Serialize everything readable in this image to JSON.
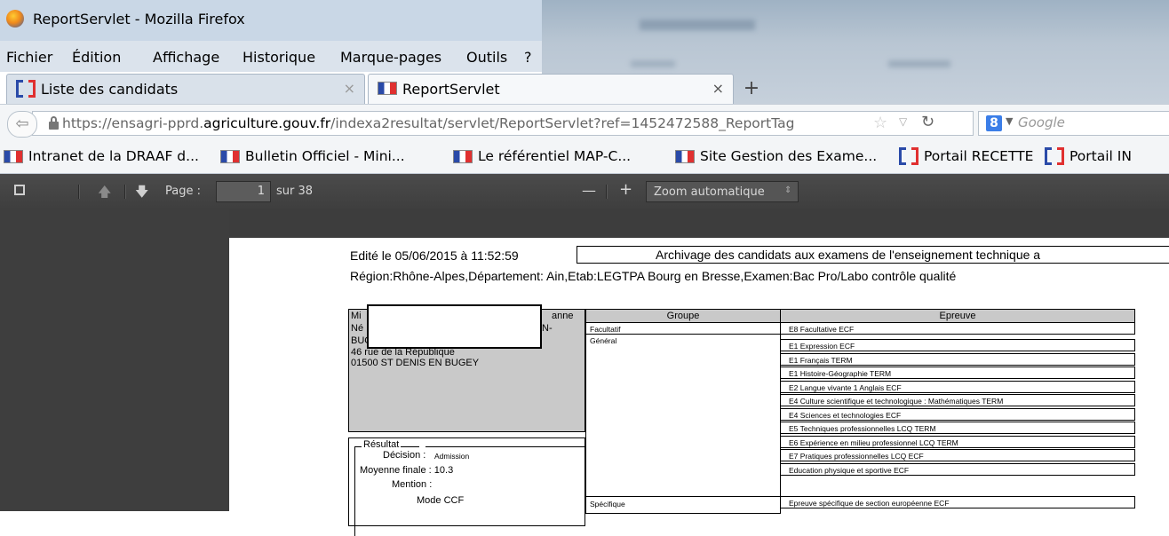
{
  "window": {
    "title": "ReportServlet - Mozilla Firefox"
  },
  "menu": [
    "Fichier",
    "Édition",
    "Affichage",
    "Historique",
    "Marque-pages",
    "Outils",
    "?"
  ],
  "tabs": [
    {
      "label": "Liste des candidats",
      "close": "×"
    },
    {
      "label": "ReportServlet",
      "close": "×"
    }
  ],
  "new_tab": "+",
  "url": {
    "prefix": "https://ensagri-pprd.",
    "domain": "agriculture.gouv.fr",
    "suffix": "/indexa2resultat/servlet/ReportServlet?ref=1452472588_ReportTag"
  },
  "search": {
    "placeholder": "Google",
    "engine_icon": "8"
  },
  "bookmarks": [
    "Intranet de la DRAAF d...",
    "Bulletin Officiel - Mini...",
    "Le référentiel MAP-C...",
    "Site Gestion des Exame...",
    "Portail RECETTE",
    "Portail IN"
  ],
  "pdf_toolbar": {
    "page_label": "Page :",
    "page_value": "1",
    "page_total": "sur 38",
    "zoom_minus": "—",
    "zoom_plus": "+",
    "zoom_value": "Zoom automatique"
  },
  "report": {
    "edited": "Edité le 05/06/2015 à  11:52:59",
    "archive_title": "Archivage des candidats aux examens de l'enseignement technique a",
    "region_line": "Région:Rhône-Alpes,Département: Ain,Etab:LEGTPA Bourg en Bresse,Examen:Bac Pro/Labo contrôle qualité",
    "candidate": {
      "line1_start": "Mi",
      "line1_end": "anne",
      "line2_start": "Né",
      "line2_end": "N-",
      "line3": "BUGEY (AIN)",
      "line4": "46 rue de la République",
      "line5": "01500 ST DENIS EN BUGEY"
    },
    "resultat": {
      "legend": "Résultat",
      "decision_label": "Décision :",
      "decision_value": "Admission",
      "moyenne": "Moyenne finale : 10.3",
      "mention": "Mention :",
      "mode": "Mode CCF"
    },
    "table": {
      "headers": [
        "Groupe",
        "Epreuve"
      ],
      "groups": [
        "Facultatif",
        "Général",
        "Spécifique"
      ],
      "epreuves": [
        "E8 Facultative  ECF",
        "E1 Expression  ECF",
        "E1 Français  TERM",
        "E1 Histoire-Géographie  TERM",
        "E2 Langue vivante 1 Anglais ECF",
        "E4 Culture scientifique et technologique : Mathématiques  TERM",
        "E4 Sciences et technologies  ECF",
        "E5 Techniques professionnelles LCQ  TERM",
        "E6 Expérience en milieu professionnel LCQ  TERM",
        "E7 Pratiques professionnelles LCQ  ECF",
        "Education physique et sportive  ECF",
        "Epreuve spécifique de section européenne  ECF"
      ]
    }
  }
}
